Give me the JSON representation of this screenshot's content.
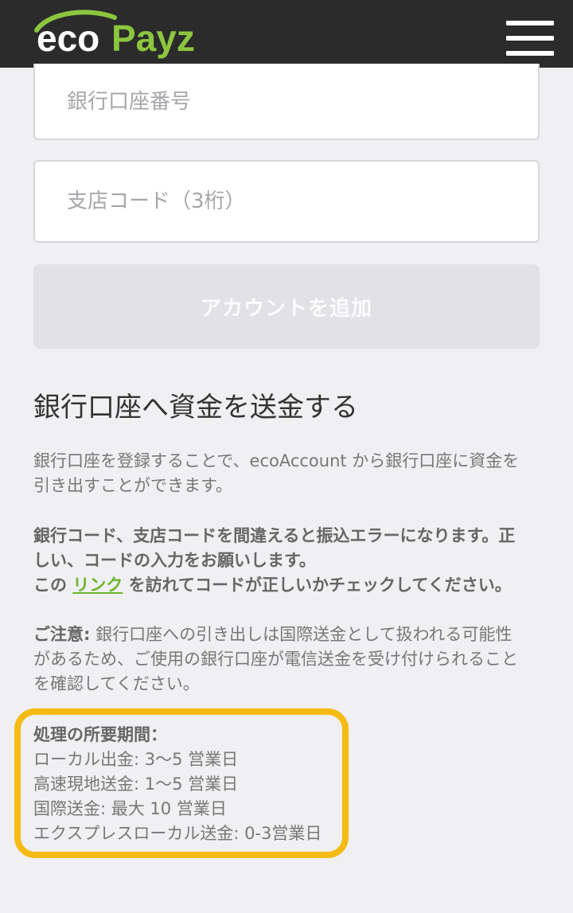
{
  "header": {
    "logo_eco": "eco",
    "logo_payz": "Payz",
    "colors": {
      "background": "#2b2b2b",
      "logo_white": "#ffffff",
      "logo_green": "#8cc63f"
    },
    "menu_icon": "hamburger-menu-icon"
  },
  "form": {
    "account_number_placeholder": "銀行口座番号",
    "account_number_value": "",
    "branch_code_placeholder": "支店コード（3桁）",
    "branch_code_value": "",
    "add_account_label": "アカウントを追加"
  },
  "transfer_section": {
    "title": "銀行口座へ資金を送金する",
    "intro_line1": "銀行口座を登録することで、ecoAccount から銀行口座に資金を",
    "intro_line2": "引き出すことができます。",
    "warning_line1": "銀行コード、支店コードを間違えると振込エラーになります。正",
    "warning_line2": "しい、コードの入力をお願いします。",
    "check_prefix": "この ",
    "check_link": "リンク",
    "check_suffix": " を訪れてコードが正しいかチェックしてください。",
    "notice_label": "ご注意:",
    "notice_line1": " 銀行口座への引き出しは国際送金として扱われる可能性",
    "notice_line2": "があるため、ご使用の銀行口座が電信送金を受け付けられること",
    "notice_line3": "を確認してください。"
  },
  "processing_time": {
    "heading": "処理の所要期間：",
    "items": [
      "ローカル出金: 3〜5 営業日",
      "高速現地送金: 1〜5 営業日",
      "国際送金: 最大 10 営業日",
      "エクスプレスローカル送金: 0-3営業日"
    ],
    "highlight_color": "#f5bb13"
  },
  "colors": {
    "page_background": "#f0f0f3",
    "link_green": "#6cb52d",
    "button_disabled": "#e2e2e6"
  }
}
